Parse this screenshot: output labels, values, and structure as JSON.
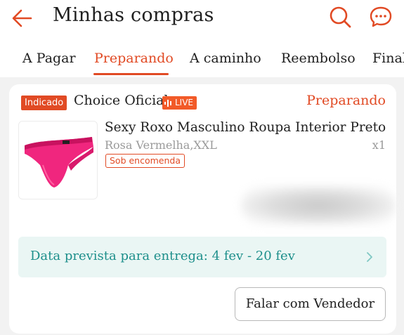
{
  "header": {
    "title": "Minhas compras",
    "back_icon": "arrow-left-icon",
    "search_icon": "search-icon",
    "chat_icon": "chat-bubble-icon",
    "accent_color": "#e14a24"
  },
  "tabs": [
    {
      "label": "A Pagar",
      "active": false
    },
    {
      "label": "Preparando",
      "active": true
    },
    {
      "label": "A caminho",
      "active": false
    },
    {
      "label": "Reembolso",
      "active": false
    },
    {
      "label": "Final",
      "active": false
    }
  ],
  "order": {
    "badge": "Indicado",
    "store_name": "Choice Oficial",
    "live_label": "LIVE",
    "status": "Preparando",
    "product": {
      "name": "Sexy Roxo Masculino Roupa Interior Preto ...",
      "variant": "Rosa Vermelha,XXL",
      "quantity": "x1",
      "tag": "Sob encomenda",
      "image": "pink-thong-underwear"
    },
    "delivery": {
      "text": "Data prevista para entrega: 4 fev - 20 fev",
      "color": "#1d8f8b"
    },
    "contact_button": "Falar com Vendedor"
  }
}
